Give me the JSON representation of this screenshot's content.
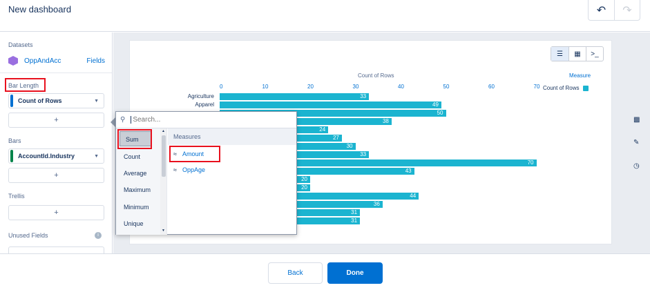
{
  "header": {
    "title": "New dashboard",
    "undo_icon": "undo-icon",
    "redo_icon": "redo-icon"
  },
  "left_panel": {
    "datasets_label": "Datasets",
    "dataset_name": "OppAndAcc",
    "fields_link": "Fields",
    "bar_length_label": "Bar Length",
    "bar_length_value": "Count of Rows",
    "add_symbol": "+",
    "bars_label": "Bars",
    "bars_value": "AccountId.Industry",
    "trellis_label": "Trellis",
    "unused_fields_label": "Unused Fields",
    "info_symbol": "i"
  },
  "colors": {
    "accent": "#0070d2",
    "bar": "#1bb4d0",
    "highlight": "#e8101d",
    "measure_grip": "#0070d2",
    "dimension_grip": "#04844b"
  },
  "chart_data": {
    "type": "bar",
    "orientation": "horizontal",
    "xlabel": "Count of Rows",
    "ticks": [
      0,
      10,
      20,
      30,
      40,
      50,
      60,
      70
    ],
    "xlim": [
      0,
      70
    ],
    "categories": [
      "Agriculture",
      "Apparel"
    ],
    "values": [
      33,
      49,
      50,
      38,
      24,
      27,
      30,
      33,
      70,
      43,
      20,
      20,
      44,
      36,
      31,
      31
    ],
    "legend_title": "Measure",
    "legend_entry": "Count of Rows",
    "legend_position": "top-right"
  },
  "popover": {
    "search_placeholder": "Search...",
    "aggregations": [
      "Sum",
      "Count",
      "Average",
      "Maximum",
      "Minimum",
      "Unique"
    ],
    "measures_header": "Measures",
    "measures": [
      "Amount",
      "OppAge"
    ]
  },
  "footer": {
    "back_label": "Back",
    "done_label": "Done"
  }
}
